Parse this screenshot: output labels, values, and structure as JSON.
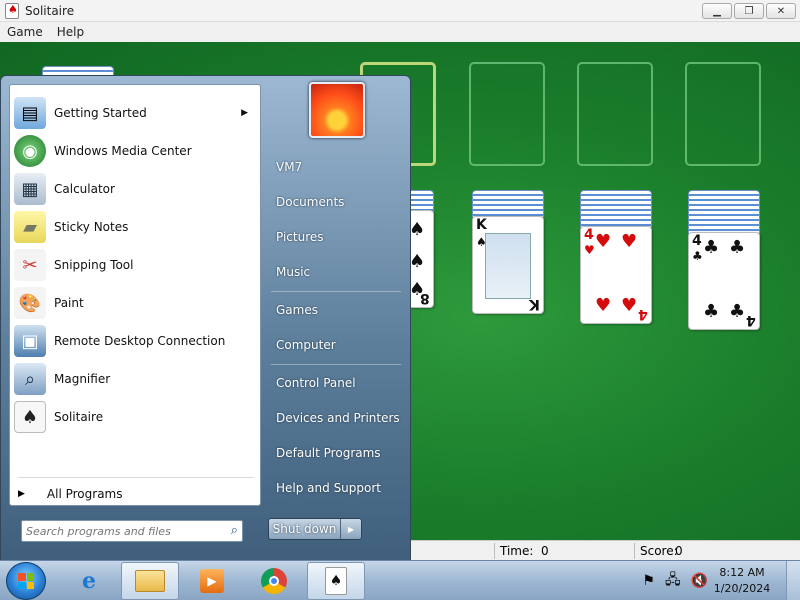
{
  "window": {
    "title": "Solitaire",
    "menu": [
      "Game",
      "Help"
    ],
    "controls": [
      "minimize",
      "maximize",
      "close"
    ]
  },
  "game": {
    "status": {
      "time_label": "Time:",
      "time_value": "0",
      "score_label": "Score:",
      "score_value": "0"
    },
    "cards": [
      {
        "rank": "8",
        "suit": "♠",
        "color": "black"
      },
      {
        "rank": "K",
        "suit": "♠",
        "color": "black"
      },
      {
        "rank": "4",
        "suit": "♥",
        "color": "red"
      },
      {
        "rank": "4",
        "suit": "♣",
        "color": "black"
      }
    ]
  },
  "start_menu": {
    "programs": [
      {
        "label": "Getting Started",
        "icon": "getting-started-icon",
        "submenu": true
      },
      {
        "label": "Windows Media Center",
        "icon": "media-center-icon"
      },
      {
        "label": "Calculator",
        "icon": "calculator-icon"
      },
      {
        "label": "Sticky Notes",
        "icon": "sticky-notes-icon"
      },
      {
        "label": "Snipping Tool",
        "icon": "snipping-tool-icon"
      },
      {
        "label": "Paint",
        "icon": "paint-icon"
      },
      {
        "label": "Remote Desktop Connection",
        "icon": "remote-desktop-icon"
      },
      {
        "label": "Magnifier",
        "icon": "magnifier-icon"
      },
      {
        "label": "Solitaire",
        "icon": "solitaire-icon"
      }
    ],
    "all_programs": "All Programs",
    "search_placeholder": "Search programs and files",
    "right": {
      "user": "VM7",
      "documents": "Documents",
      "pictures": "Pictures",
      "music": "Music",
      "games": "Games",
      "computer": "Computer",
      "control_panel": "Control Panel",
      "devices_printers": "Devices and Printers",
      "default_programs": "Default Programs",
      "help_support": "Help and Support"
    },
    "shutdown": "Shut down"
  },
  "taskbar": {
    "time": "8:12 AM",
    "date": "1/20/2024",
    "pinned": [
      "internet-explorer-icon",
      "file-explorer-icon",
      "media-player-icon",
      "chrome-icon",
      "solitaire-icon"
    ]
  }
}
